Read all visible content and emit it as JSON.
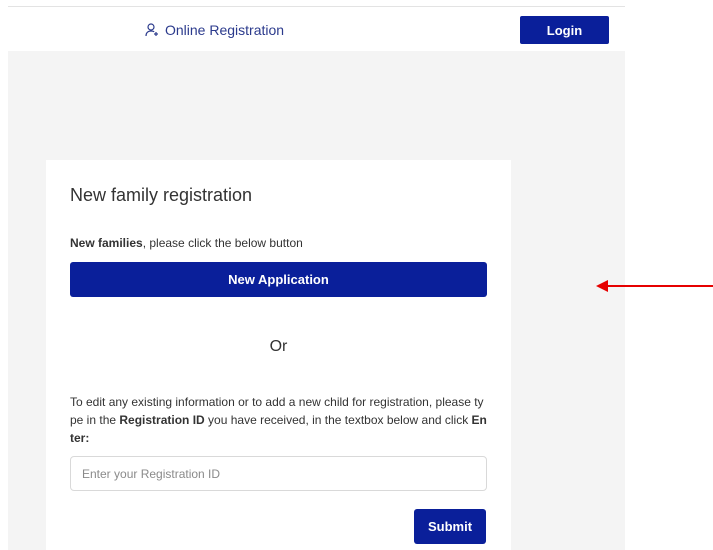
{
  "header": {
    "nav_label": "Online Registration",
    "nav_icon": "user-add-icon",
    "login_label": "Login"
  },
  "card": {
    "title": "New family registration",
    "intro_bold": "New families",
    "intro_rest": ", please click the below button",
    "new_application_label": "New Application",
    "or_label": "Or",
    "edit_text_1": "To edit any existing information or to add a new child for registration, please type in the ",
    "edit_text_bold_1": "Registration ID",
    "edit_text_2": " you have received, in the textbox below and click ",
    "edit_text_bold_2": "Enter:",
    "registration_id": {
      "value": "",
      "placeholder": "Enter your Registration ID"
    },
    "submit_label": "Submit"
  },
  "annotation": {
    "arrow_icon": "red-arrow-left-icon"
  },
  "colors": {
    "primary": "#0a1f9a",
    "link": "#2b3a8c",
    "content_background": "#f4f4f4",
    "annotation_arrow": "#e60000"
  }
}
